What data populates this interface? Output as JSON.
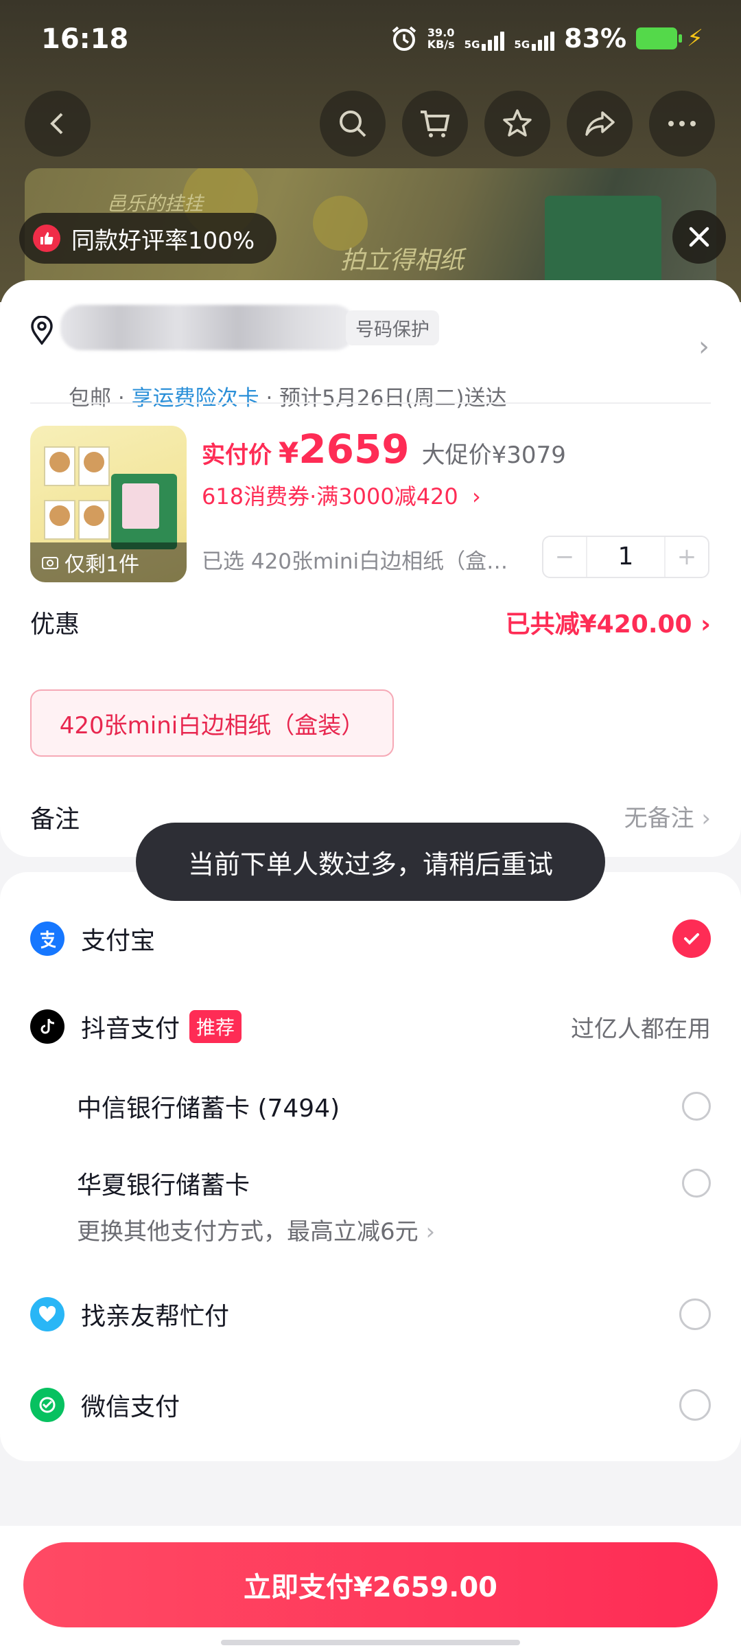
{
  "status_bar": {
    "time": "16:18",
    "net_speed_value": "39.0",
    "net_speed_unit": "KB/s",
    "sim1": "5G",
    "sim2": "5G",
    "battery": "83%"
  },
  "top_nav": {
    "icons": [
      "back-icon",
      "search-icon",
      "cart-icon",
      "star-icon",
      "share-icon",
      "more-icon"
    ]
  },
  "banner": {
    "text1": "邑乐的挂挂",
    "text2": "拍立得相纸"
  },
  "rating_pill": {
    "label": "同款好评率100%"
  },
  "address": {
    "name_suffix": "站",
    "protect_tag": "号码保护",
    "free_shipping": "包邮",
    "insurance": "享运费险次卡",
    "delivery": "预计5月26日(周二)送达",
    "separator": "·"
  },
  "product": {
    "stock_label": "仅剩1件",
    "price_label": "实付价",
    "currency": "¥",
    "price": "2659",
    "promo_price": "大促价¥3079",
    "coupon": "618消费券·满3000减420",
    "spec": "已选 420张mini白边相纸（盒装）",
    "quantity": "1",
    "minus": "−",
    "plus": "+"
  },
  "discount": {
    "label": "优惠",
    "value": "已共减¥420.00"
  },
  "variant_chip": "420张mini白边相纸（盒装）",
  "note": {
    "label": "备注",
    "value": "无备注"
  },
  "toast": "当前下单人数过多，请稍后重试",
  "payment": {
    "alipay": "支付宝",
    "douyin": "抖音支付",
    "douyin_tag": "推荐",
    "douyin_slogan": "过亿人都在用",
    "card1": "中信银行储蓄卡 (7494)",
    "card2": "华夏银行储蓄卡",
    "more_methods": "更换其他支付方式，最高立减6元",
    "friend_pay": "找亲友帮忙付",
    "wechat": "微信支付"
  },
  "pay_button": "立即支付¥2659.00",
  "colors": {
    "accent": "#fe2c55",
    "link_blue": "#2a8fd8",
    "alipay_blue": "#1677ff",
    "wechat_green": "#07c160"
  }
}
